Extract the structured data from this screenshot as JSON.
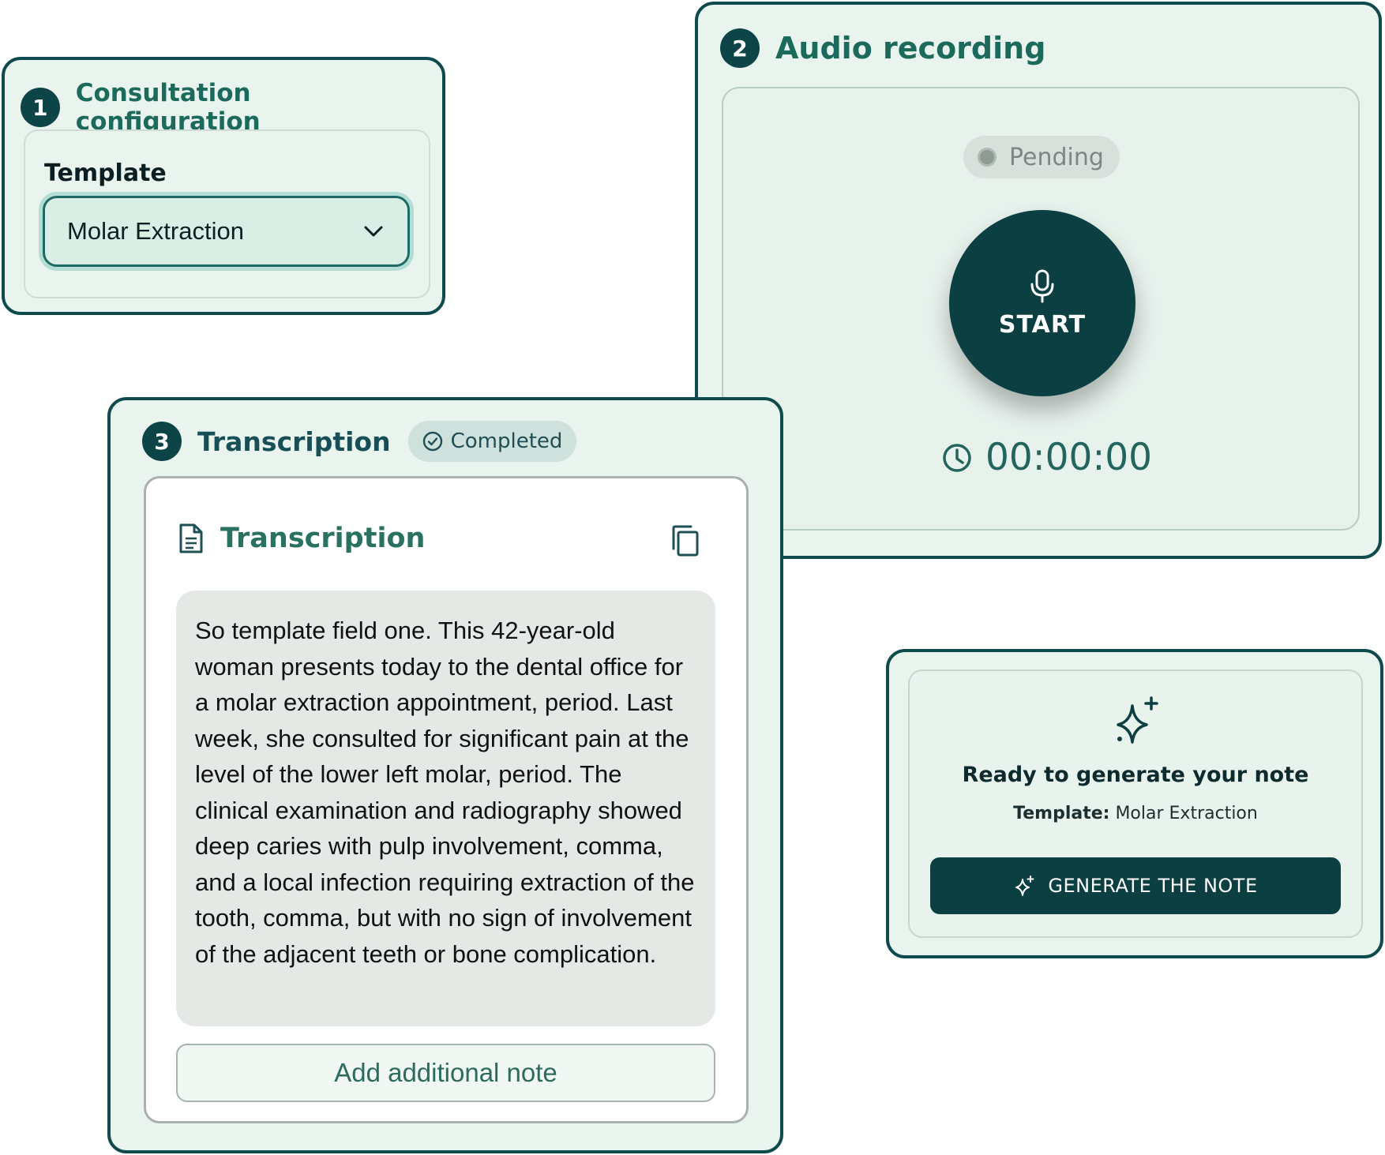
{
  "config": {
    "step_number": "1",
    "title": "Consultation configuration",
    "template_label": "Template",
    "template_value": "Molar Extraction"
  },
  "audio": {
    "step_number": "2",
    "title": "Audio recording",
    "status": "Pending",
    "start_label": "START",
    "timer": "00:00:00"
  },
  "transcription": {
    "step_number": "3",
    "title": "Transcription",
    "badge": "Completed",
    "section_title": "Transcription",
    "text": "So template field one. This 42-year-old woman presents today to the dental office for a molar extraction appointment, period. Last week, she consulted for significant pain at the level of the lower left molar, period. The clinical examination and radiography showed deep caries with pulp involvement, comma, and a local infection requiring extraction of the tooth, comma, but with no sign of involvement of the adjacent teeth or bone complication.",
    "add_note_label": "Add additional note"
  },
  "generate": {
    "title": "Ready to generate your note",
    "template_label": "Template:",
    "template_value": "Molar Extraction",
    "button_label": "GENERATE THE NOTE"
  },
  "icons": [
    "chevron-down-icon",
    "microphone-icon",
    "clock-icon",
    "check-circle-icon",
    "document-icon",
    "copy-icon",
    "sparkle-icon"
  ],
  "colors": {
    "primary": "#0b3f42",
    "card_bg": "#eaf4ee",
    "accent_text": "#1c6a5c",
    "badge_bg": "#cfe1dc",
    "pending_bg": "#d8e0dc"
  }
}
